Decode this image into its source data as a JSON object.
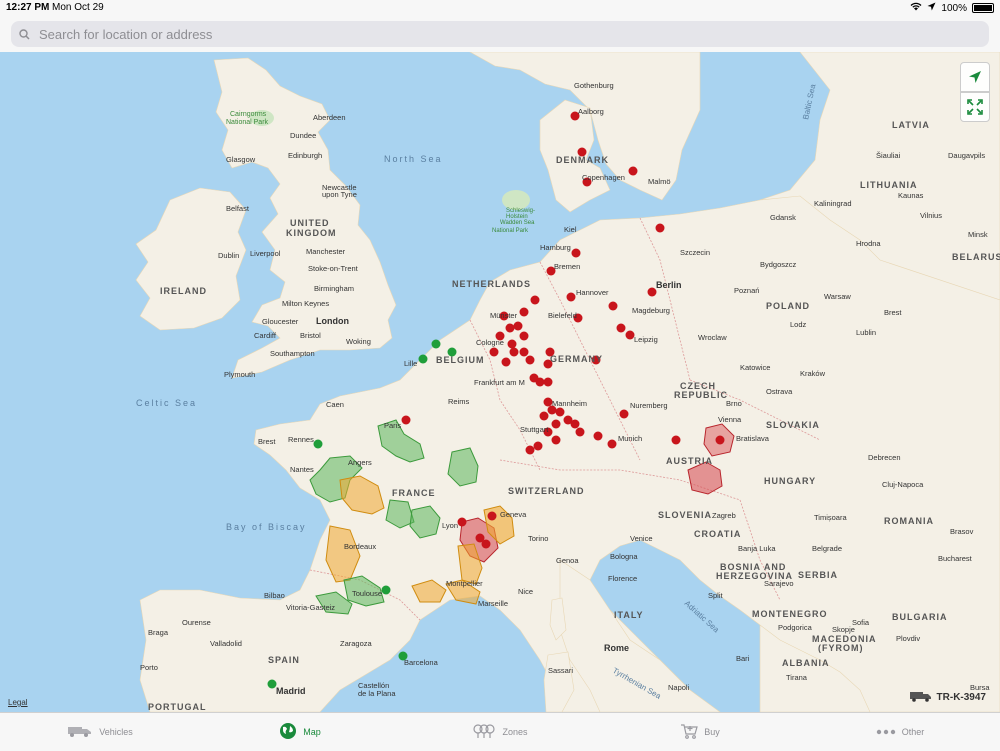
{
  "status": {
    "time": "12:27 PM",
    "date": "Mon Oct 29",
    "battery": "100%"
  },
  "search": {
    "placeholder": "Search for location or address"
  },
  "map": {
    "legal": "Legal",
    "vehicle_id": "TR-K-3947",
    "labels": {
      "north_sea": "North Sea",
      "celtic_sea": "Celtic Sea",
      "bay_of_biscay": "Bay of Biscay",
      "baltic_sea": "Baltic Sea",
      "adriatic_sea": "Adriatic Sea",
      "tyrrhenian_sea": "Tyrrhenian Sea",
      "cairngorms": "Cairngorms",
      "national_park": "National Park",
      "wadden1": "Schleswig-",
      "wadden2": "Holstein",
      "wadden3": "Wadden Sea",
      "wadden4": "National Park",
      "united_kingdom": "UNITED",
      "kingdom": "KINGDOM",
      "ireland": "IRELAND",
      "netherlands": "NETHERLANDS",
      "belgium": "BELGIUM",
      "germany": "GERMANY",
      "denmark": "DENMARK",
      "france": "FRANCE",
      "switzerland": "SWITZERLAND",
      "spain": "SPAIN",
      "portugal": "PORTUGAL",
      "italy": "ITALY",
      "austria": "AUSTRIA",
      "czech": "CZECH",
      "republic": "REPUBLIC",
      "poland": "POLAND",
      "lithuania": "LITHUANIA",
      "latvia": "LATVIA",
      "belarus": "BELARUS",
      "slovakia": "SLOVAKIA",
      "hungary": "HUNGARY",
      "romania": "ROMANIA",
      "slovenia": "SLOVENIA",
      "croatia": "CROATIA",
      "bosnia1": "BOSNIA AND",
      "bosnia2": "HERZEGOVINA",
      "serbia": "SERBIA",
      "montenegro": "MONTENEGRO",
      "bulgaria": "BULGARIA",
      "macedonia1": "MACEDONIA",
      "macedonia2": "(FYROM)",
      "albania": "ALBANIA",
      "aberdeen": "Aberdeen",
      "dundee": "Dundee",
      "glasgow": "Glasgow",
      "edinburgh": "Edinburgh",
      "newcastle": "Newcastle",
      "upon_tyne": "upon Tyne",
      "belfast": "Belfast",
      "dublin": "Dublin",
      "liverpool": "Liverpool",
      "manchester": "Manchester",
      "stoke": "Stoke-on-Trent",
      "birmingham": "Birmingham",
      "milton": "Milton Keynes",
      "gloucester": "Gloucester",
      "london": "London",
      "cardiff": "Cardiff",
      "bristol": "Bristol",
      "woking": "Woking",
      "southampton": "Southampton",
      "plymouth": "Plymouth",
      "caen": "Caen",
      "brest": "Brest",
      "rennes": "Rennes",
      "nantes": "Nantes",
      "angers": "Angers",
      "paris": "Paris",
      "reims": "Reims",
      "lille": "Lille",
      "lyon": "Lyon",
      "geneva": "Geneva",
      "bordeaux": "Bordeaux",
      "montpellier": "Montpellier",
      "marseille": "Marseille",
      "nice": "Nice",
      "toulouse": "Toulouse",
      "bilbao": "Bilbao",
      "vitoria": "Vitoria-Gasteiz",
      "zaragoza": "Zaragoza",
      "barcelona": "Barcelona",
      "ourense": "Ourense",
      "valladolid": "Valladolid",
      "porto": "Porto",
      "braga": "Braga",
      "madrid": "Madrid",
      "castellon1": "Castellón",
      "castellon2": "de la Plana",
      "aalborg": "Aalborg",
      "gothenburg": "Gothenburg",
      "copenhagen": "Copenhagen",
      "malmo": "Malmö",
      "kiel": "Kiel",
      "hamburg": "Hamburg",
      "bremen": "Bremen",
      "hannover": "Hannover",
      "bielefeld": "Bielefeld",
      "munster": "Münster",
      "cologne": "Cologne",
      "frankfurt": "Frankfurt am M",
      "berlin": "Berlin",
      "szczecin": "Szczecin",
      "magdeburg": "Magdeburg",
      "leipzig": "Leipzig",
      "mannheim": "Mannheim",
      "stuttgart": "Stuttgart",
      "nuremberg": "Nuremberg",
      "munich": "Munich",
      "torino": "Torino",
      "genoa": "Genoa",
      "venice": "Venice",
      "bologna": "Bologna",
      "florence": "Florence",
      "rome": "Rome",
      "sassari": "Sassari",
      "napoli": "Napoli",
      "bari": "Bari",
      "zagreb": "Zagreb",
      "banja_luka": "Banja Luka",
      "belgrade": "Belgrade",
      "sarajevo": "Sarajevo",
      "split": "Split",
      "podgorica": "Podgorica",
      "skopje": "Skopje",
      "tirana": "Tirana",
      "sofia": "Sofia",
      "plovdiv": "Plovdiv",
      "bucharest": "Bucharest",
      "cluj": "Cluj-Napoca",
      "timisoara": "Timișoara",
      "brasov": "Brasov",
      "bratislava": "Bratislava",
      "vienna": "Vienna",
      "brno": "Brno",
      "ostrava": "Ostrava",
      "katowice": "Katowice",
      "krakow": "Kraków",
      "wroclaw": "Wroclaw",
      "lodz": "Lodz",
      "warsaw": "Warsaw",
      "poznan": "Poznań",
      "bydgoszcz": "Bydgoszcz",
      "gdansk": "Gdansk",
      "kaliningrad": "Kaliningrad",
      "lublin": "Lublin",
      "brest_by": "Brest",
      "minsk": "Minsk",
      "hrodna": "Hrodna",
      "vilnius": "Vilnius",
      "kaunas": "Kaunas",
      "siauliai": "Šiauliai",
      "daugavpils": "Daugavpils",
      "debrecen": "Debrecen",
      "bursa": "Bursa"
    }
  },
  "tabs": [
    {
      "label": "Vehicles",
      "icon": "truck-icon"
    },
    {
      "label": "Map",
      "icon": "globe-icon"
    },
    {
      "label": "Zones",
      "icon": "zones-icon"
    },
    {
      "label": "Buy",
      "icon": "cart-icon"
    },
    {
      "label": "Other",
      "icon": "more-icon"
    }
  ],
  "colors": {
    "active_tab": "#1a8a3c",
    "inactive_tab": "#8e8e93",
    "marker_red": "#c8151c",
    "marker_green": "#1f9e3a",
    "zone_green": "#5bb65b",
    "zone_orange": "#f0a830",
    "zone_red": "#d6454c",
    "sea": "#a9d3f0",
    "land": "#f4f0e6"
  }
}
